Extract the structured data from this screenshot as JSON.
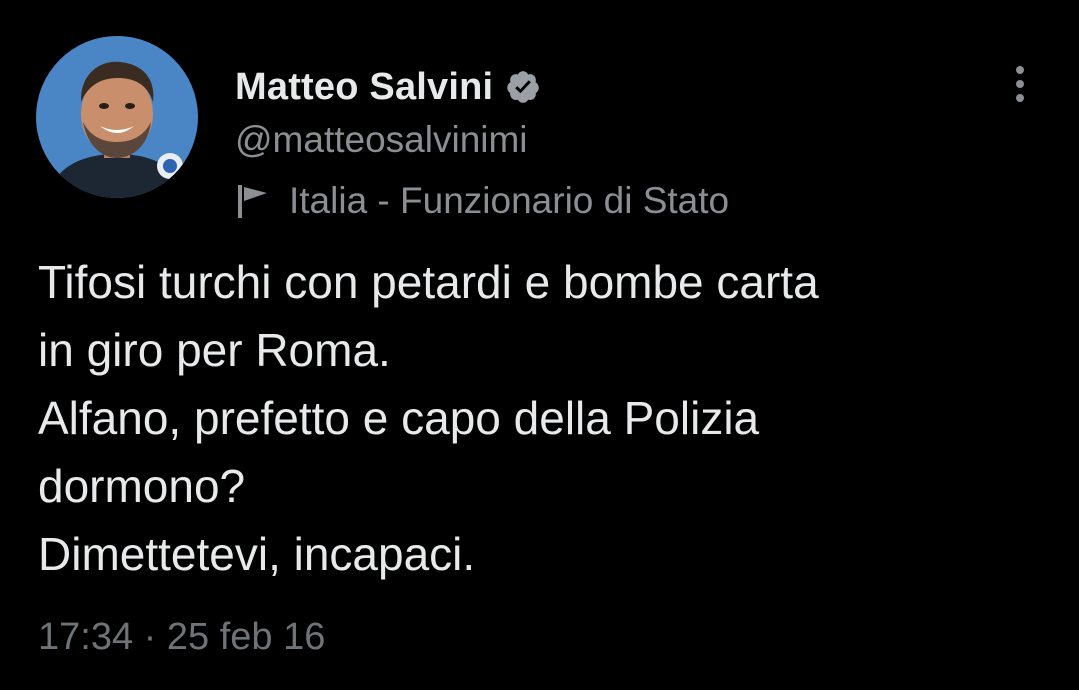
{
  "author": {
    "display_name": "Matteo Salvini",
    "handle": "@matteosalvinimi",
    "verified": true,
    "affiliation": "Italia - Funzionario di Stato"
  },
  "icons": {
    "verified": "verified-badge-icon",
    "affiliation": "flag-icon",
    "menu": "more-options-icon"
  },
  "tweet": {
    "lines": [
      "Tifosi turchi con petardi e bombe carta",
      "in giro per Roma.",
      "Alfano, prefetto e capo della Polizia",
      "dormono?",
      "Dimettetevi, incapaci."
    ],
    "timestamp": "17:34 · 25 feb 16"
  },
  "colors": {
    "background": "#000000",
    "primary_text": "#e7e9ea",
    "secondary_text": "#8b8f94",
    "avatar_background": "#4a86c6",
    "verified_badge": "#9aa0a6"
  }
}
